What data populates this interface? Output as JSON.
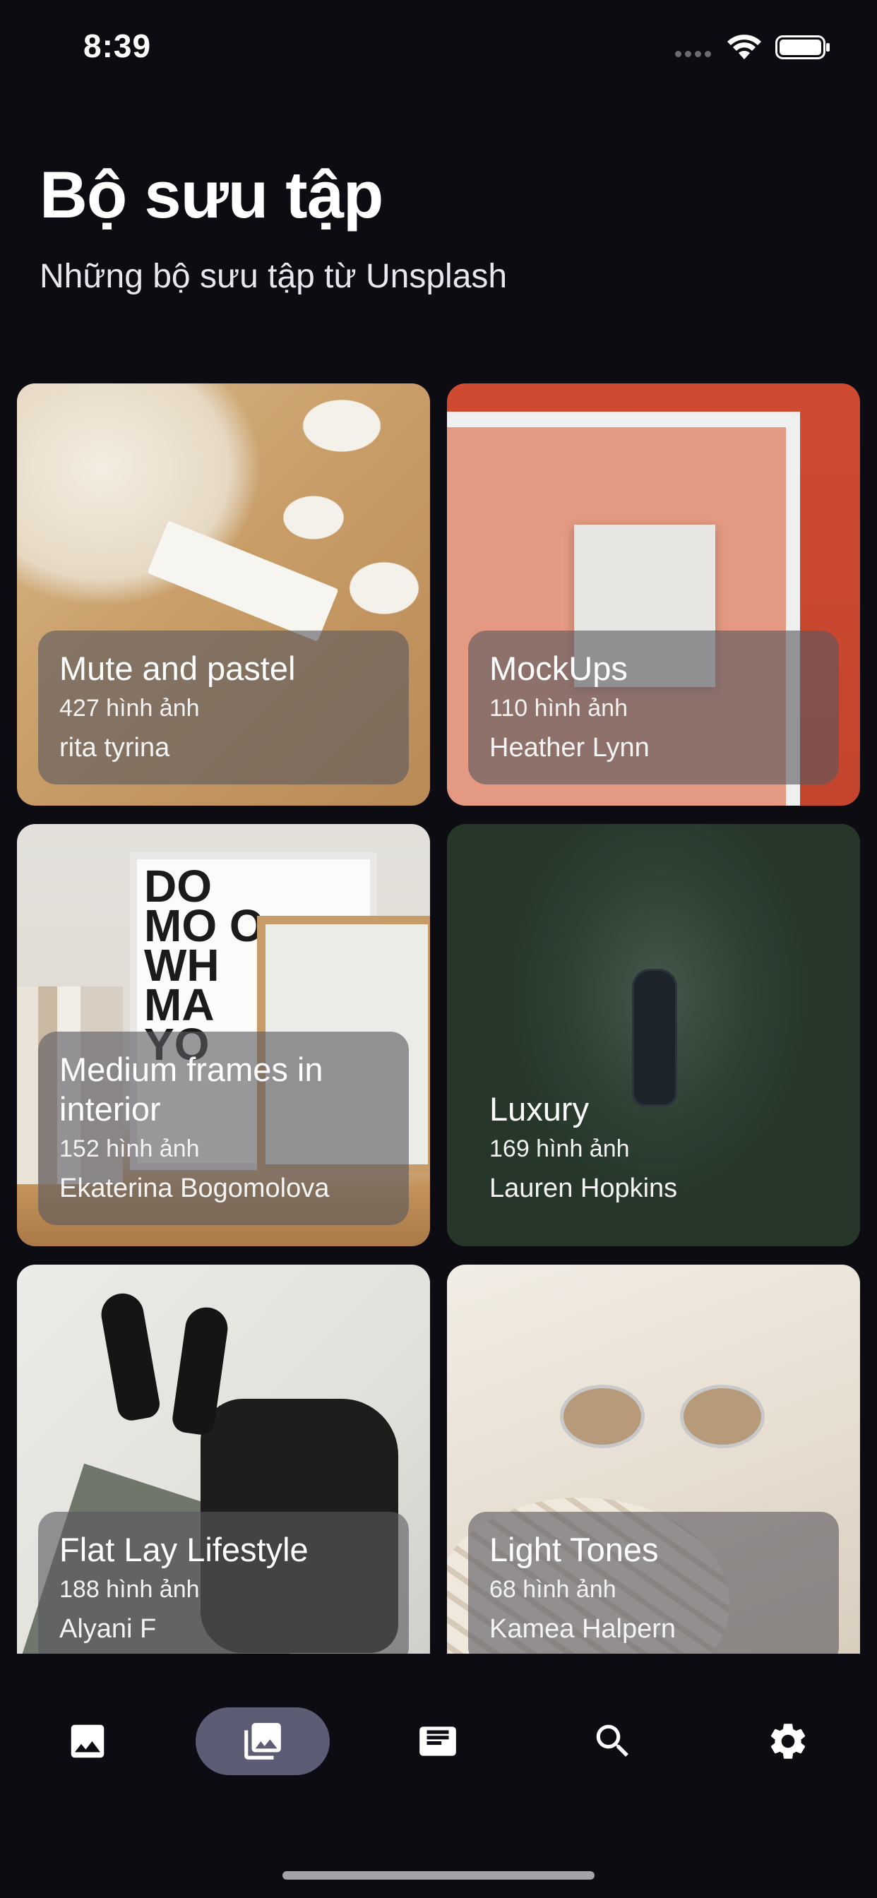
{
  "status_bar": {
    "time": "8:39"
  },
  "header": {
    "title": "Bộ sưu tập",
    "subtitle": "Những bộ sưu tập từ Unsplash"
  },
  "collections": [
    {
      "title": "Mute and pastel",
      "count": "427 hình ảnh",
      "author": "rita tyrina"
    },
    {
      "title": "MockUps",
      "count": "110 hình ảnh",
      "author": "Heather Lynn"
    },
    {
      "title": "Medium frames in interior",
      "count": "152 hình ảnh",
      "author": "Ekaterina Bogomolova"
    },
    {
      "title": "Luxury",
      "count": "169 hình ảnh",
      "author": "Lauren Hopkins"
    },
    {
      "title": "Flat Lay Lifestyle",
      "count": "188 hình ảnh",
      "author": "Alyani F"
    },
    {
      "title": "Light Tones",
      "count": "68 hình ảnh",
      "author": "Kamea Halpern"
    }
  ],
  "photo_text": {
    "poster": "DO MO O WH MA YO"
  },
  "bottom_nav": {
    "items": [
      {
        "icon": "image-icon"
      },
      {
        "icon": "photo-library-icon",
        "active": true
      },
      {
        "icon": "article-icon"
      },
      {
        "icon": "search-icon"
      },
      {
        "icon": "settings-icon"
      }
    ]
  },
  "colors": {
    "background": "#0d0c13",
    "nav_active_pill": "#5d5c75",
    "card_overlay": "rgba(90,88,96,0.62)"
  }
}
